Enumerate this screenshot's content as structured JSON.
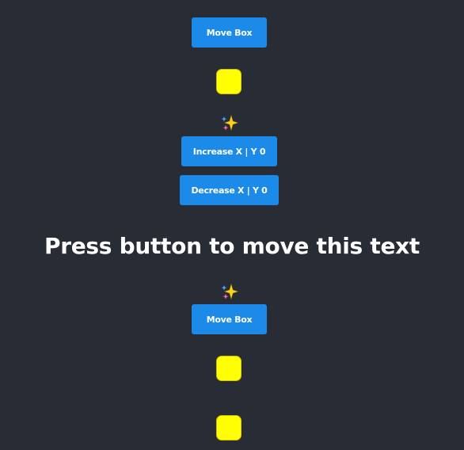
{
  "colors": {
    "background": "#282c34",
    "button": "#1b8ae8",
    "box": "#ffff00"
  },
  "top_move_button": {
    "label": "Move Box"
  },
  "increase_button": {
    "label": "Increase X | Y 0"
  },
  "decrease_button": {
    "label": "Decrease X | Y 0"
  },
  "headline": {
    "text": "Press button to move this text"
  },
  "bottom_move_button": {
    "label": "Move Box"
  },
  "icons": {
    "sparkle": "sparkles-icon"
  }
}
